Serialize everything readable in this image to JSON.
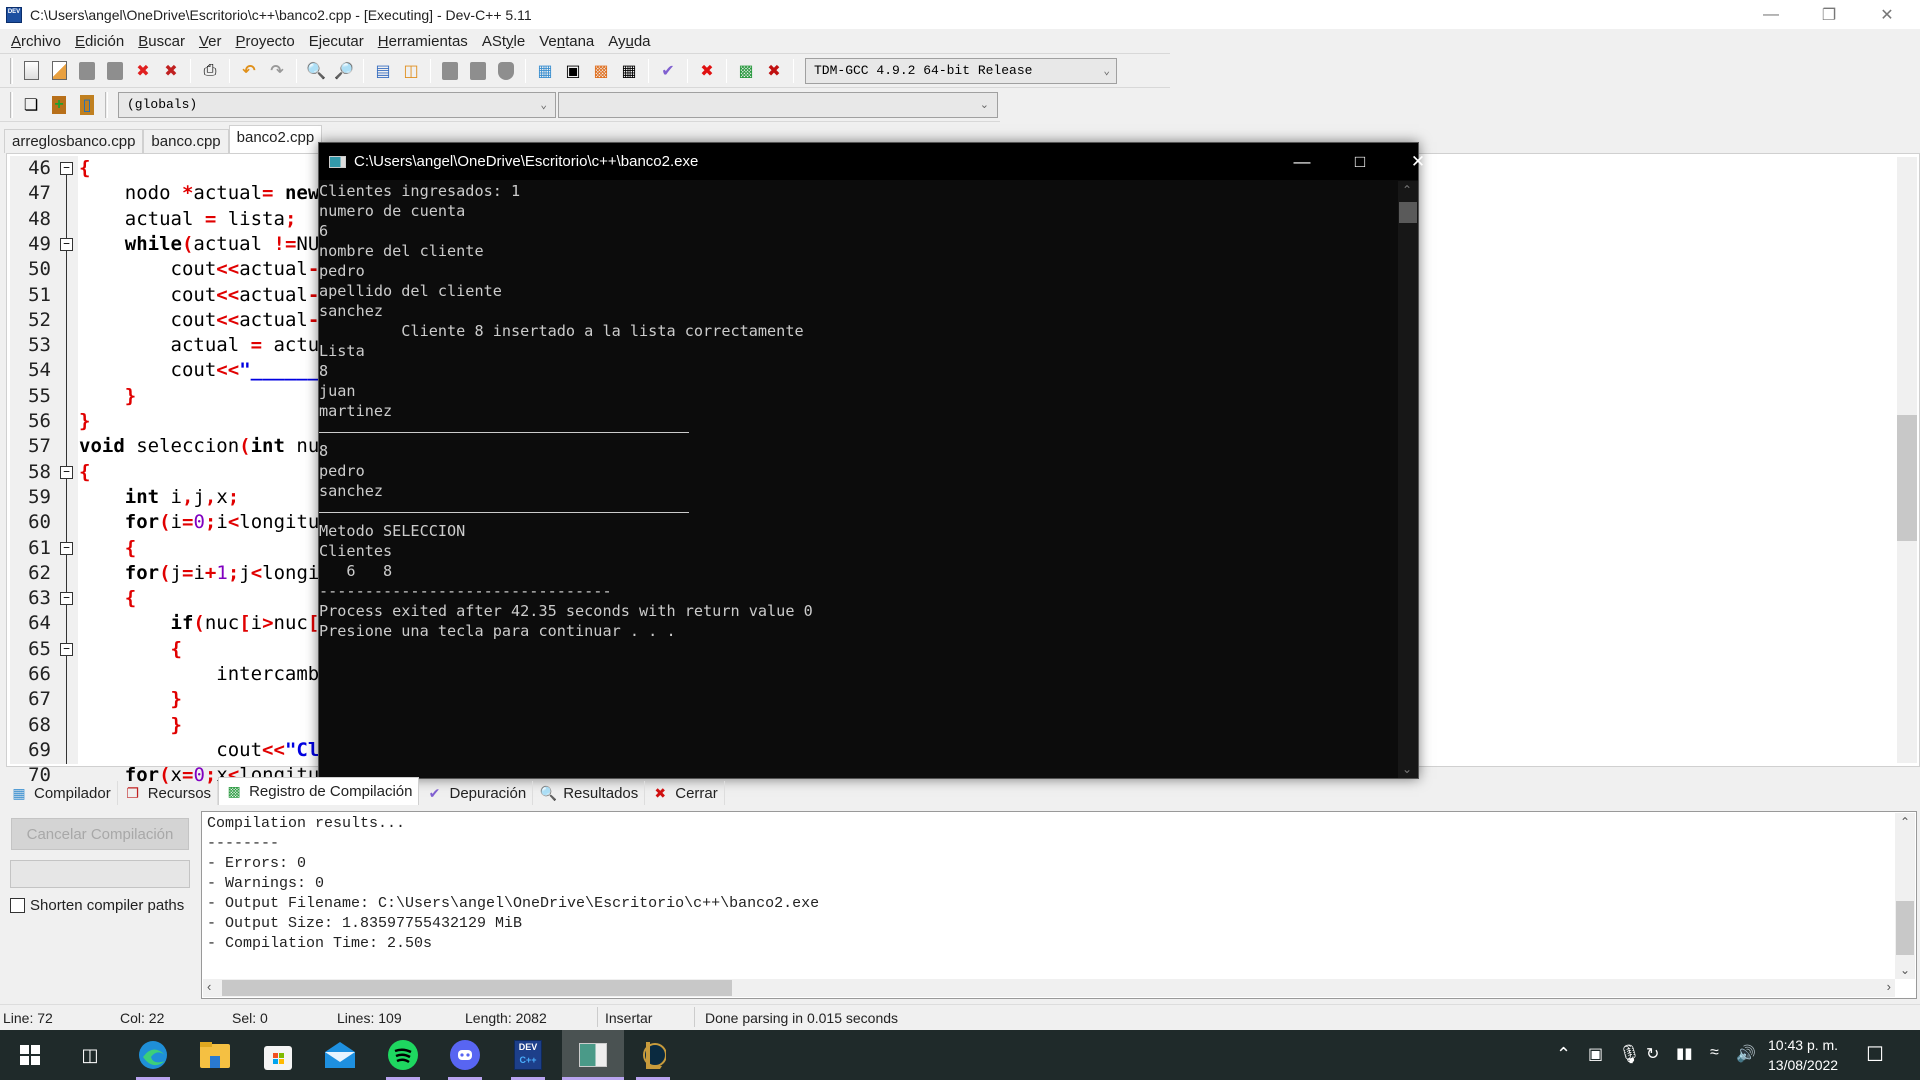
{
  "window": {
    "title": "C:\\Users\\angel\\OneDrive\\Escritorio\\c++\\banco2.cpp - [Executing] - Dev-C++ 5.11",
    "app_icon": "devcpp-icon"
  },
  "menu": [
    "Archivo",
    "Edición",
    "Buscar",
    "Ver",
    "Proyecto",
    "Ejecutar",
    "Herramientas",
    "AStyle",
    "Ventana",
    "Ayuda"
  ],
  "toolbar": {
    "compiler_select": "TDM-GCC 4.9.2 64-bit Release",
    "globals_select": "(globals)",
    "members_select": ""
  },
  "editor": {
    "tabs": [
      {
        "label": "arreglosbanco.cpp",
        "active": false
      },
      {
        "label": "banco.cpp",
        "active": false
      },
      {
        "label": "banco2.cpp",
        "active": true
      }
    ],
    "lines": [
      {
        "n": "46",
        "text": "{"
      },
      {
        "n": "47",
        "text": "    nodo *actual= new"
      },
      {
        "n": "48",
        "text": "    actual = lista;"
      },
      {
        "n": "49",
        "text": "    while(actual !=NU"
      },
      {
        "n": "50",
        "text": "        cout<<actual-"
      },
      {
        "n": "51",
        "text": "        cout<<actual-"
      },
      {
        "n": "52",
        "text": "        cout<<actual-"
      },
      {
        "n": "53",
        "text": "        actual = actu"
      },
      {
        "n": "54",
        "text": "        cout<<\"______"
      },
      {
        "n": "55",
        "text": "    }"
      },
      {
        "n": "56",
        "text": "}"
      },
      {
        "n": "57",
        "text": "void seleccion(int nu"
      },
      {
        "n": "58",
        "text": "{"
      },
      {
        "n": "59",
        "text": "    int i,j,x;"
      },
      {
        "n": "60",
        "text": "    for(i=0;i<longitu"
      },
      {
        "n": "61",
        "text": "    {"
      },
      {
        "n": "62",
        "text": "    for(j=i+1;j<longi"
      },
      {
        "n": "63",
        "text": "    {"
      },
      {
        "n": "64",
        "text": "        if(nuc[i>nuc["
      },
      {
        "n": "65",
        "text": "        {"
      },
      {
        "n": "66",
        "text": "            intercamb"
      },
      {
        "n": "67",
        "text": "        }"
      },
      {
        "n": "68",
        "text": "        }"
      },
      {
        "n": "69",
        "text": "            cout<<\"Cl"
      },
      {
        "n": "70",
        "text": "    for(x=0;x<longitu"
      }
    ]
  },
  "console": {
    "title": "C:\\Users\\angel\\OneDrive\\Escritorio\\c++\\banco2.exe",
    "lines": [
      "Clientes ingresados: 1",
      "numero de cuenta",
      "6",
      "nombre del cliente",
      "pedro",
      "apellido del cliente",
      "sanchez",
      "         Cliente 8 insertado a la lista correctamente",
      "Lista",
      "8",
      "juan",
      "martinez",
      "__UNDERLINE__",
      "8",
      "pedro",
      "sanchez",
      "__UNDERLINE__",
      "Metodo SELECCION",
      "Clientes",
      "   6   8",
      "--------------------------------",
      "Process exited after 42.35 seconds with return value 0",
      "Presione una tecla para continuar . . ."
    ]
  },
  "bottom_panel": {
    "tabs": [
      {
        "label": "Compilador",
        "icon": "compiler-grid-icon",
        "active": false
      },
      {
        "label": "Recursos",
        "icon": "resources-icon",
        "active": false
      },
      {
        "label": "Registro de Compilación",
        "icon": "bar-chart-icon",
        "active": true
      },
      {
        "label": "Depuración",
        "icon": "check-icon",
        "active": false
      },
      {
        "label": "Resultados",
        "icon": "search-results-icon",
        "active": false
      },
      {
        "label": "Cerrar",
        "icon": "close-red-icon",
        "active": false
      }
    ],
    "cancel_button": "Cancelar Compilación",
    "shorten_paths_label": "Shorten compiler paths",
    "shorten_paths_checked": false,
    "log": [
      "Compilation results...",
      "--------",
      "- Errors: 0",
      "- Warnings: 0",
      "- Output Filename: C:\\Users\\angel\\OneDrive\\Escritorio\\c++\\banco2.exe",
      "- Output Size: 1.83597755432129 MiB",
      "- Compilation Time: 2.50s"
    ]
  },
  "status": {
    "line": "Line:   72",
    "col": "Col:   22",
    "sel": "Sel:   0",
    "lines": "Lines:   109",
    "length": "Length:  2082",
    "mode": "Insertar",
    "message": "Done parsing in 0.015 seconds"
  },
  "taskbar": {
    "apps": [
      "start",
      "task-view",
      "edge",
      "file-explorer",
      "store",
      "mail",
      "spotify",
      "discord",
      "devcpp",
      "console",
      "league-of-legends"
    ],
    "time": "10:43 p. m.",
    "date": "13/08/2022"
  },
  "colors": {
    "keyword": "#000000",
    "symbol": "#e00000",
    "number": "#8000c0",
    "string": "#0000e0",
    "console_bg": "#0c0c0c",
    "console_fg": "#cccccc",
    "taskbar_bg": "#1f2a2a"
  }
}
